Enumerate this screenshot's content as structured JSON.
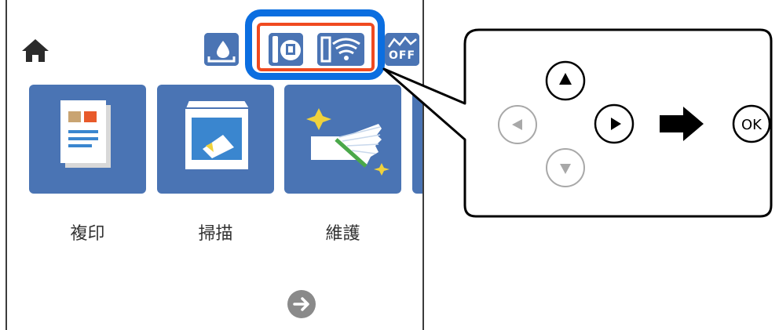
{
  "panel": {
    "home_icon": "home-icon",
    "status_icons": [
      "ink-level-icon",
      "wired-network-icon",
      "wifi-icon",
      "wifi-direct-off-icon"
    ],
    "wifi_direct_label": "OFF",
    "tiles": [
      {
        "label": "複印",
        "icon": "copy-icon"
      },
      {
        "label": "掃描",
        "icon": "scan-icon"
      },
      {
        "label": "維護",
        "icon": "maintenance-icon"
      }
    ],
    "next_icon": "arrow-right-circle-icon"
  },
  "callout": {
    "buttons": [
      {
        "name": "up",
        "icon": "triangle-up-icon",
        "active": true
      },
      {
        "name": "left",
        "icon": "triangle-left-icon",
        "active": false
      },
      {
        "name": "right",
        "icon": "triangle-right-icon",
        "active": true
      },
      {
        "name": "down",
        "icon": "triangle-down-icon",
        "active": false
      }
    ],
    "arrow_icon": "arrow-right-icon",
    "ok_label": "OK"
  },
  "colors": {
    "tile_blue": "#4a74b4",
    "highlight_blue": "#0b6ee0",
    "highlight_red": "#f04a20"
  }
}
